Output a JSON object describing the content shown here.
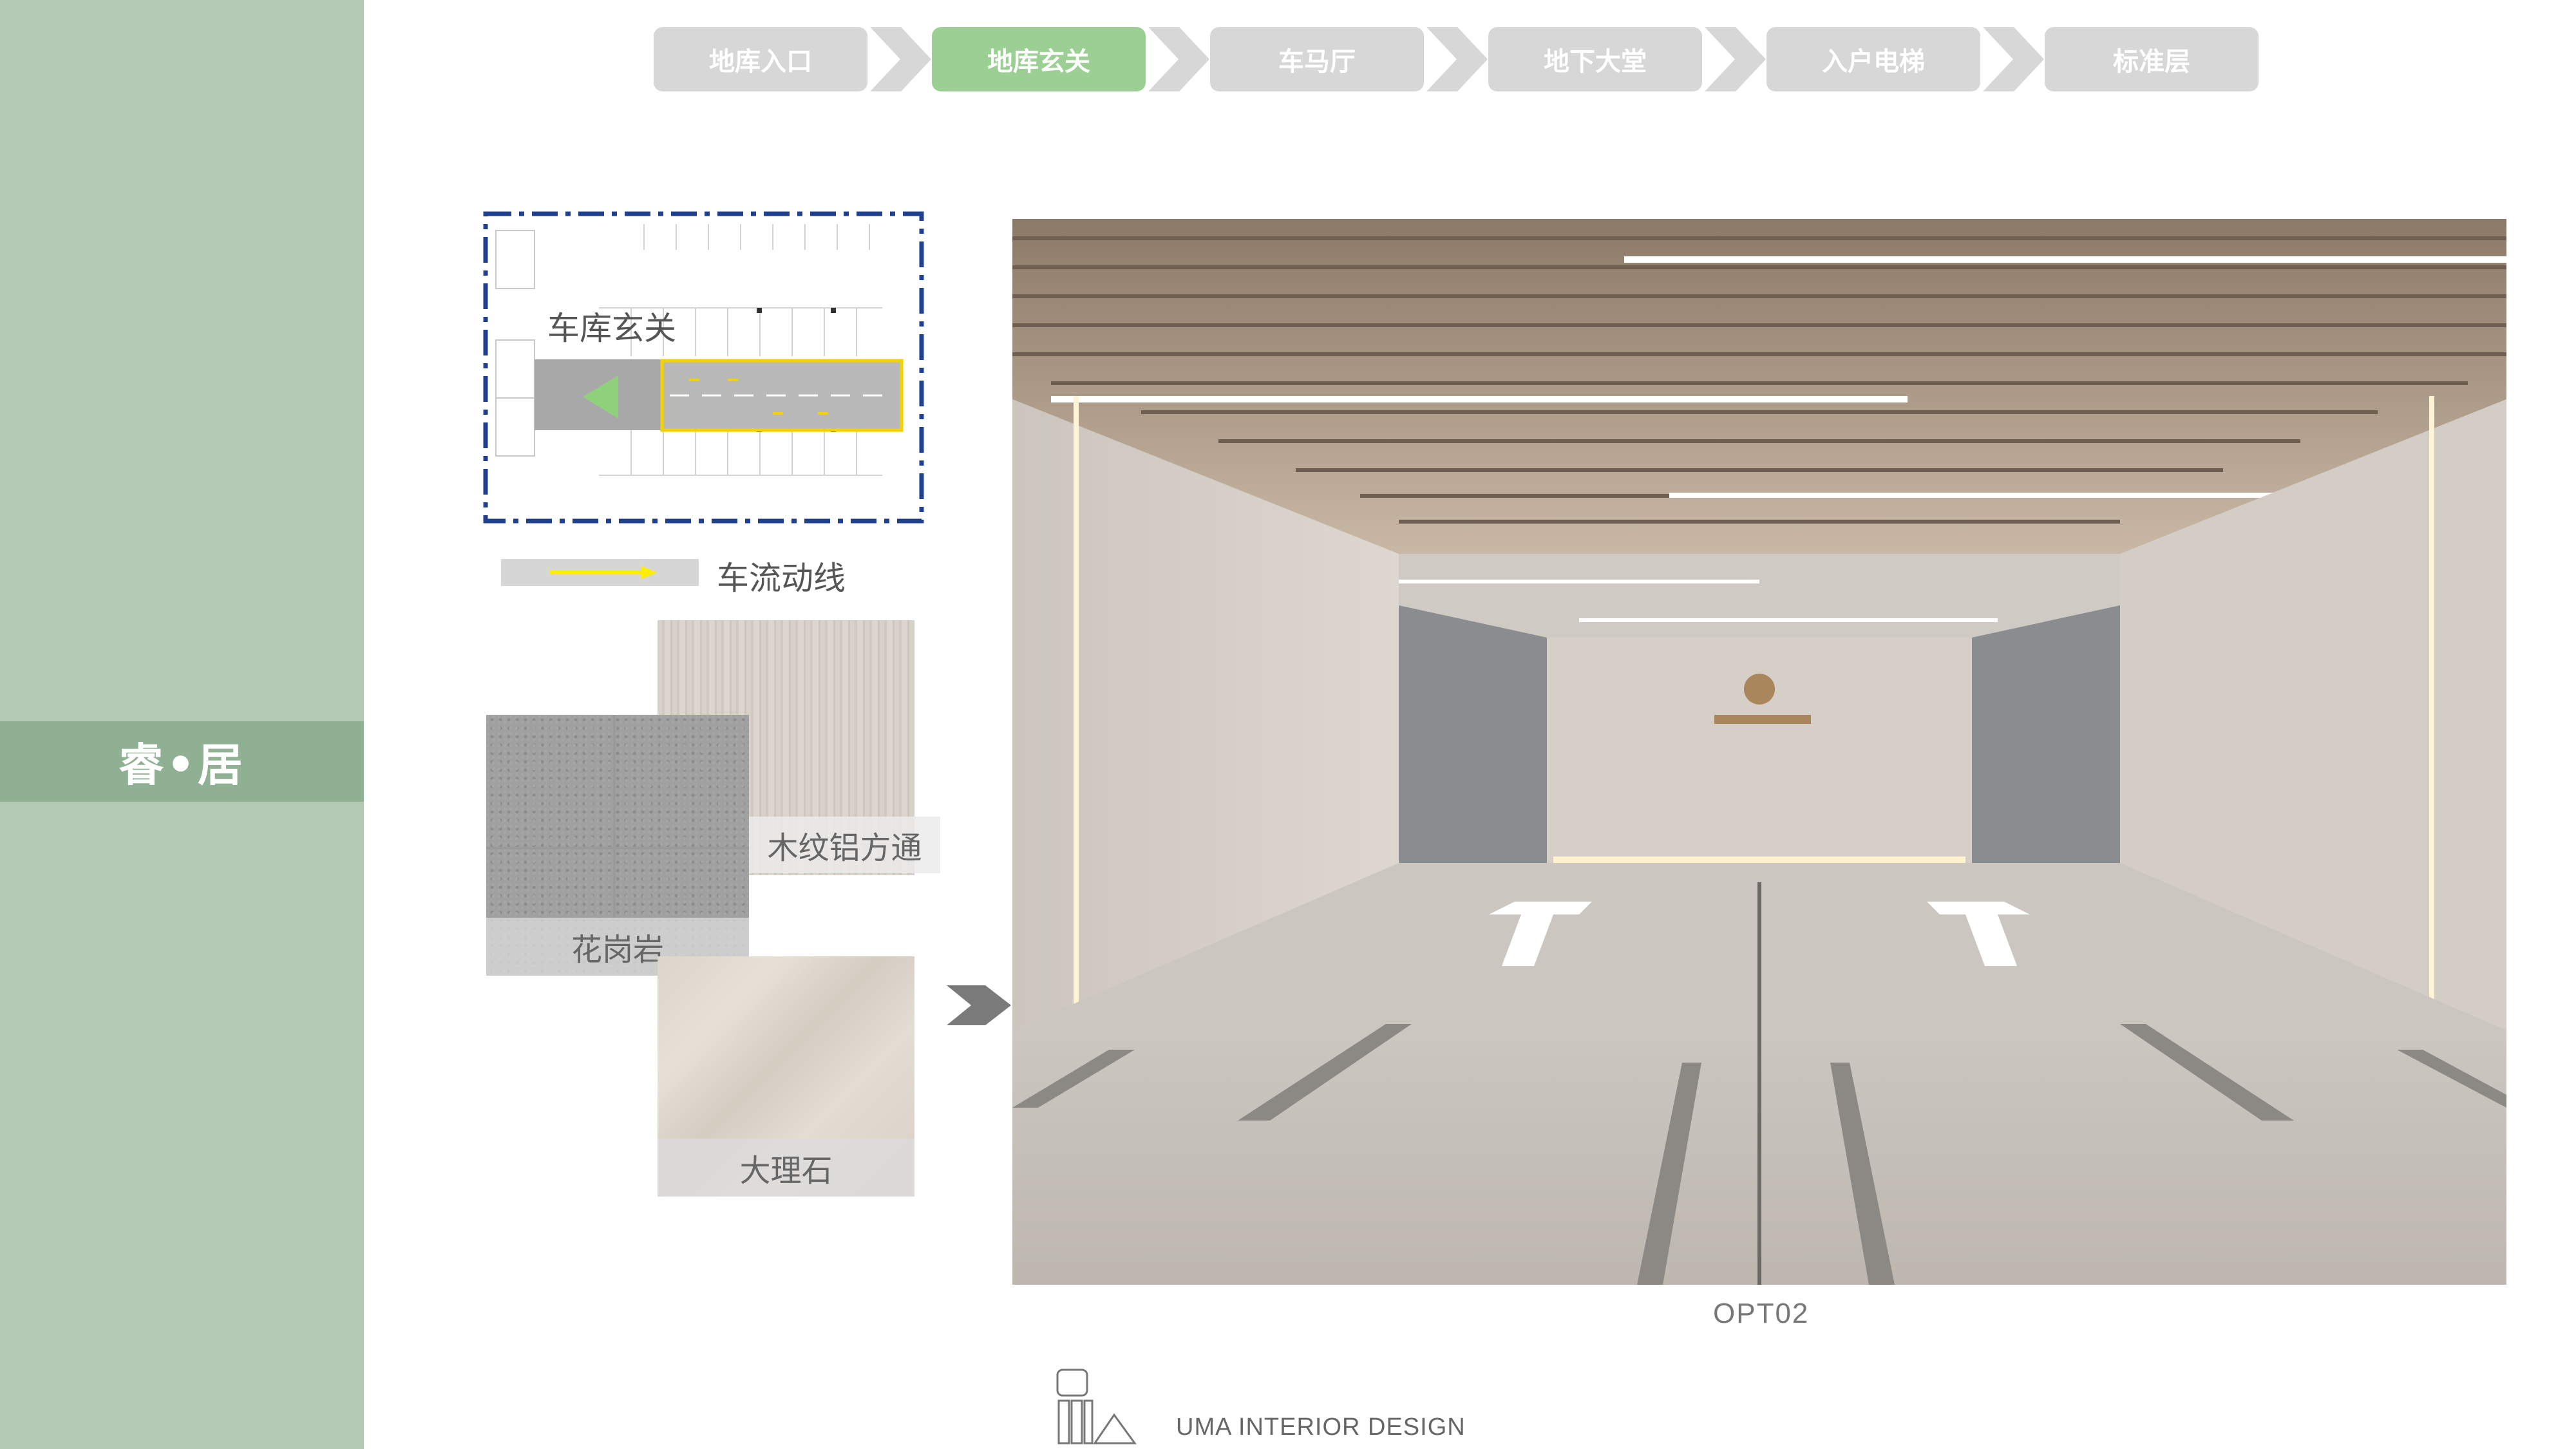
{
  "sidebar": {
    "brand": "睿•居"
  },
  "nav": {
    "steps": [
      {
        "label": "地库入口",
        "active": false
      },
      {
        "label": "地库玄关",
        "active": true
      },
      {
        "label": "车马厅",
        "active": false
      },
      {
        "label": "地下大堂",
        "active": false
      },
      {
        "label": "入户电梯",
        "active": false
      },
      {
        "label": "标准层",
        "active": false
      }
    ],
    "active_color": "#9ccf94",
    "inactive_color": "#d7d7d7"
  },
  "plan": {
    "label": "车库玄关",
    "legend_label": "车流动线"
  },
  "materials": {
    "wood": "木纹铝方通",
    "granite": "花岗岩",
    "marble": "大理石"
  },
  "render": {
    "caption": "OPT02"
  },
  "footer": {
    "company": "UMA INTERIOR DESIGN"
  },
  "colors": {
    "sidebar": "#b3c9b4",
    "sidebar_band": "#8fb092",
    "plan_border": "#1f3f8f",
    "flow_arrow": "#ffee00"
  }
}
